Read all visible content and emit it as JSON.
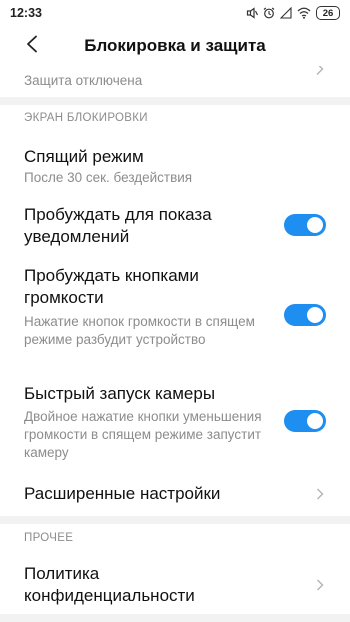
{
  "status_bar": {
    "time": "12:33",
    "battery": "26",
    "icons": [
      "mute-icon",
      "alarm-icon",
      "signal-icon",
      "wifi-icon",
      "battery-icon"
    ]
  },
  "header": {
    "title": "Блокировка и защита",
    "back_icon": "back-arrow-icon"
  },
  "partial_item": {
    "subtitle": "Защита отключена"
  },
  "lock_screen_section": {
    "header": "ЭКРАН БЛОКИРОВКИ",
    "items": [
      {
        "title": "Спящий режим",
        "subtitle": "После 30 сек. бездействия"
      },
      {
        "title": "Пробуждать для показа уведомлений",
        "toggle": true
      },
      {
        "title": "Пробуждать кнопками громкости",
        "subtitle": "Нажатие кнопок громкости в спящем режиме разбудит устройство",
        "toggle": true
      },
      {
        "title": "Быстрый запуск камеры",
        "subtitle": "Двойное нажатие кнопки уменьшения громкости в спящем режиме запустит камеру",
        "toggle": true
      },
      {
        "title": "Расширенные настройки"
      }
    ]
  },
  "other_section": {
    "header": "ПРОЧЕЕ",
    "items": [
      {
        "title": "Политика конфиденциальности"
      }
    ]
  },
  "colors": {
    "toggle_on": "#1e8ef0",
    "section_gap": "#f2f2f2",
    "secondary_text": "#8c8c8c"
  }
}
